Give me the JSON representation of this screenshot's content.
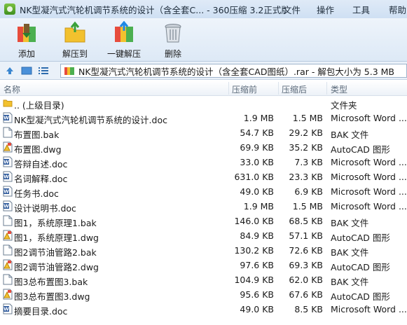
{
  "window": {
    "title": "NK型凝汽式汽轮机调节系统的设计（含全套C... - 360压缩 3.2正式版",
    "menu": [
      "文件",
      "操作",
      "工具",
      "帮助"
    ]
  },
  "toolbar": {
    "buttons": [
      {
        "label": "添加",
        "icon": "add-archive-icon"
      },
      {
        "label": "解压到",
        "icon": "extract-to-icon"
      },
      {
        "label": "一键解压",
        "icon": "one-click-extract-icon"
      },
      {
        "label": "删除",
        "icon": "trash-icon"
      }
    ]
  },
  "address": {
    "path": "NK型凝汽式汽轮机调节系统的设计（含全套CAD图纸）.rar - 解包大小为 5.3 MB"
  },
  "columns": {
    "name": "名称",
    "size": "压缩前",
    "packed": "压缩后",
    "type": "类型"
  },
  "files": [
    {
      "name": ".. (上级目录)",
      "size": "",
      "packed": "",
      "type": "文件夹",
      "icon": "folder-icon"
    },
    {
      "name": "NK型凝汽式汽轮机调节系统的设计.doc",
      "size": "1.9 MB",
      "packed": "1.5 MB",
      "type": "Microsoft Word ...",
      "icon": "word-doc-icon"
    },
    {
      "name": "布置图.bak",
      "size": "54.7 KB",
      "packed": "29.2 KB",
      "type": "BAK 文件",
      "icon": "blank-file-icon"
    },
    {
      "name": "布置图.dwg",
      "size": "69.9 KB",
      "packed": "35.2 KB",
      "type": "AutoCAD 图形",
      "icon": "autocad-dwg-icon"
    },
    {
      "name": "答辩自述.doc",
      "size": "33.0 KB",
      "packed": "7.3 KB",
      "type": "Microsoft Word ...",
      "icon": "word-doc-icon"
    },
    {
      "name": "名词解释.doc",
      "size": "631.0 KB",
      "packed": "23.3 KB",
      "type": "Microsoft Word ...",
      "icon": "word-doc-icon"
    },
    {
      "name": "任务书.doc",
      "size": "49.0 KB",
      "packed": "6.9 KB",
      "type": "Microsoft Word ...",
      "icon": "word-doc-icon"
    },
    {
      "name": "设计说明书.doc",
      "size": "1.9 MB",
      "packed": "1.5 MB",
      "type": "Microsoft Word ...",
      "icon": "word-doc-icon"
    },
    {
      "name": "图1，系统原理1.bak",
      "size": "146.0 KB",
      "packed": "68.5 KB",
      "type": "BAK 文件",
      "icon": "blank-file-icon"
    },
    {
      "name": "图1，系统原理1.dwg",
      "size": "84.9 KB",
      "packed": "57.1 KB",
      "type": "AutoCAD 图形",
      "icon": "autocad-dwg-icon"
    },
    {
      "name": "图2调节油管路2.bak",
      "size": "130.2 KB",
      "packed": "72.6 KB",
      "type": "BAK 文件",
      "icon": "blank-file-icon"
    },
    {
      "name": "图2调节油管路2.dwg",
      "size": "97.6 KB",
      "packed": "69.3 KB",
      "type": "AutoCAD 图形",
      "icon": "autocad-dwg-icon"
    },
    {
      "name": "图3总布置图3.bak",
      "size": "104.9 KB",
      "packed": "62.0 KB",
      "type": "BAK 文件",
      "icon": "blank-file-icon"
    },
    {
      "name": "图3总布置图3.dwg",
      "size": "95.6 KB",
      "packed": "67.6 KB",
      "type": "AutoCAD 图形",
      "icon": "autocad-dwg-icon"
    },
    {
      "name": "摘要目录.doc",
      "size": "49.0 KB",
      "packed": "8.5 KB",
      "type": "Microsoft Word ...",
      "icon": "word-doc-icon"
    }
  ],
  "colors": {
    "titlebar": "#cfe0f3",
    "toolbar": "#dde9f6",
    "word_blue": "#2b579a",
    "autocad_yellow": "#f2c12e"
  }
}
